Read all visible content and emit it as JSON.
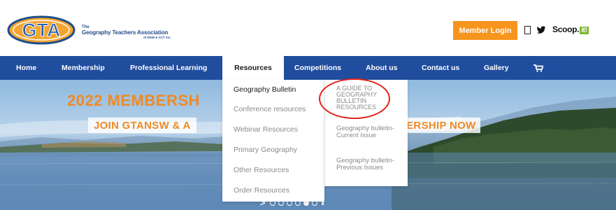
{
  "header": {
    "logo_text": "GTA",
    "org_prefix": "The",
    "org_name": "Geography Teachers Association",
    "org_suffix": "of NSW & ACT Inc.",
    "login_label": "Member Login",
    "facebook_glyph": "",
    "scoop_label": "Scoop.",
    "scoop_it": "it!"
  },
  "nav": {
    "items": [
      {
        "label": "Home"
      },
      {
        "label": "Membership"
      },
      {
        "label": "Professional Learning"
      },
      {
        "label": "Resources"
      },
      {
        "label": "Competitions"
      },
      {
        "label": "About us"
      },
      {
        "label": "Contact us"
      },
      {
        "label": "Gallery"
      }
    ],
    "active": "Resources",
    "cart_icon": "cart-icon"
  },
  "hero": {
    "title": "2022 MEMBERSH",
    "join_left": "JOIN GTANSW & A",
    "join_right": "BERSHIP NOW",
    "slider_arrow": ">",
    "slider_pause": "II",
    "slide_count": 5,
    "active_slide": 4
  },
  "dropdown": {
    "items": [
      {
        "label": "Geography Bulletin",
        "active": true
      },
      {
        "label": "Conference resources",
        "active": false
      },
      {
        "label": "Webinar Resources",
        "active": false
      },
      {
        "label": "Primary Geography",
        "active": false
      },
      {
        "label": "Other Resources",
        "active": false
      },
      {
        "label": "Order Resources",
        "active": false
      }
    ]
  },
  "submenu": {
    "items": [
      {
        "label": "A GUIDE TO GEOGRAPHY BULLETIN RESOURCES"
      },
      {
        "label": "Geography bulletin- Current Issue"
      },
      {
        "label": "Geography bulletin- Previous Issues"
      }
    ]
  },
  "colors": {
    "nav_bg": "#204d9e",
    "accent_orange": "#f7941d",
    "highlight_circle": "#e0201b"
  }
}
